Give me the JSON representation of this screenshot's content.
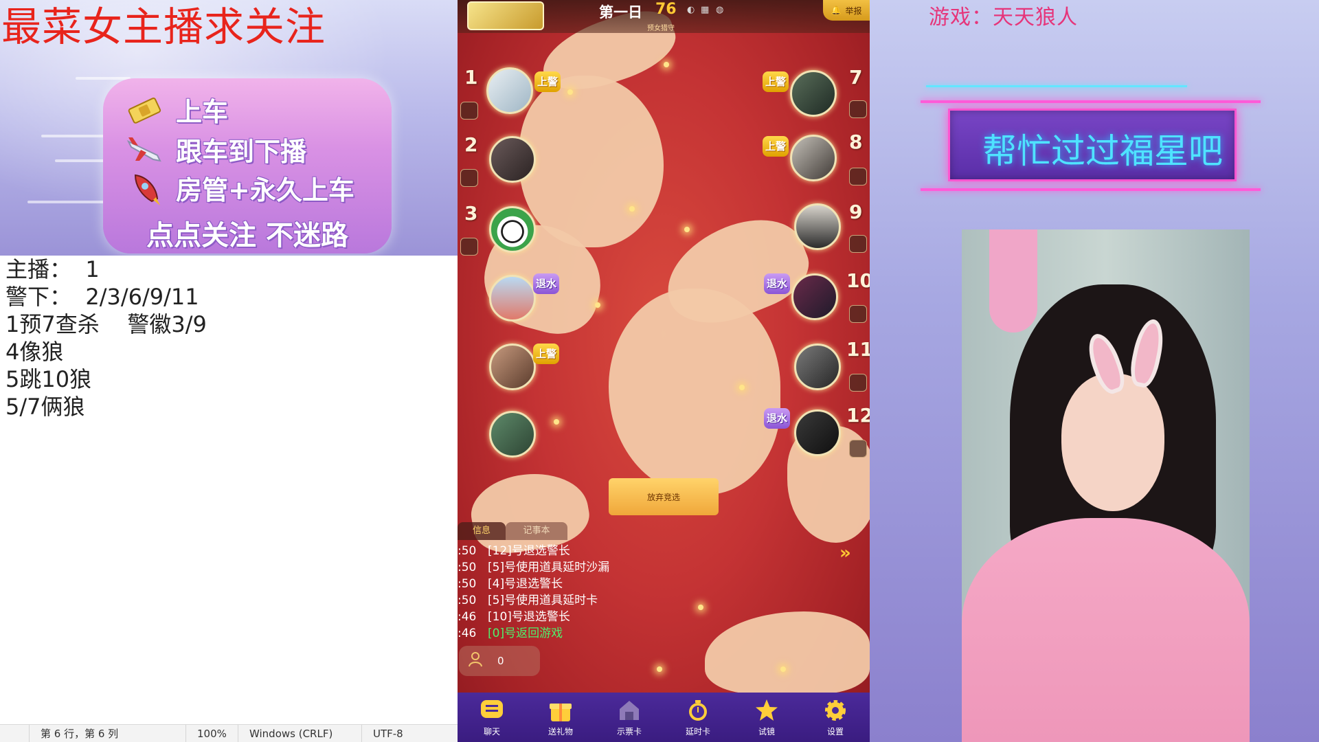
{
  "left": {
    "stream_title": "最菜女主播求关注",
    "promo": {
      "items": [
        {
          "icon": "ticket-icon",
          "label": "上车"
        },
        {
          "icon": "plane-icon",
          "label": "跟车到下播"
        },
        {
          "icon": "rocket-icon",
          "label": "房管+永久上车"
        }
      ],
      "follow": "点点关注  不迷路"
    }
  },
  "notepad": {
    "lines": [
      "主播：  1",
      "警下：  2/3/6/9/11",
      "1预7查杀    警徽3/9",
      "4像狼",
      "5跳10狼",
      "5/7俩狼"
    ],
    "status": {
      "position": "第 6 行，第 6 列",
      "zoom": "100%",
      "line_ending": "Windows (CRLF)",
      "encoding": "UTF-8"
    }
  },
  "game": {
    "day_label": "第一日",
    "timer": "76",
    "role_label": "预女猎守",
    "report": "举报",
    "left_seats": [
      {
        "num": "1",
        "badge": "上警",
        "badge_type": "up"
      },
      {
        "num": "2",
        "badge": "",
        "badge_type": ""
      },
      {
        "num": "3",
        "badge": "",
        "badge_type": ""
      },
      {
        "num": "",
        "badge": "退水",
        "badge_type": "retreat"
      },
      {
        "num": "",
        "badge": "上警",
        "badge_type": "up"
      },
      {
        "num": "",
        "badge": "",
        "badge_type": ""
      }
    ],
    "right_seats": [
      {
        "num": "7",
        "badge": "上警",
        "badge_type": "up"
      },
      {
        "num": "8",
        "badge": "上警",
        "badge_type": "up"
      },
      {
        "num": "9",
        "badge": "",
        "badge_type": ""
      },
      {
        "num": "10",
        "badge": "退水",
        "badge_type": "retreat"
      },
      {
        "num": "11",
        "badge": "",
        "badge_type": ""
      },
      {
        "num": "12",
        "badge": "退水",
        "badge_type": "retreat"
      }
    ],
    "abstain_button": "放弃竞选",
    "chat_tabs": [
      "信息",
      "记事本"
    ],
    "chat_log": [
      {
        "time": ":50",
        "msg": "[12]号退选警长",
        "color": "white"
      },
      {
        "time": ":50",
        "msg": "[5]号使用道具延时沙漏",
        "color": "white"
      },
      {
        "time": ":50",
        "msg": "[4]号退选警长",
        "color": "white"
      },
      {
        "time": ":50",
        "msg": "[5]号使用道具延时卡",
        "color": "white"
      },
      {
        "time": ":46",
        "msg": "[10]号退选警长",
        "color": "white"
      },
      {
        "time": ":46",
        "msg": "[0]号返回游戏",
        "color": "green"
      }
    ],
    "mic_count": "0",
    "bottom_bar": [
      {
        "icon": "chat-icon",
        "label": "聊天"
      },
      {
        "icon": "gift-icon",
        "label": "送礼物"
      },
      {
        "icon": "ticket-show-icon",
        "label": "示票卡"
      },
      {
        "icon": "timer-card-icon",
        "label": "延时卡"
      },
      {
        "icon": "star-icon",
        "label": "试镜"
      },
      {
        "icon": "settings-icon",
        "label": "设置"
      }
    ]
  },
  "right": {
    "game_name": "游戏：天天狼人",
    "banner_text": "帮忙过过福星吧"
  },
  "colors": {
    "title_red": "#e8241c",
    "neon_cyan": "#4fe3ff",
    "neon_pink": "#ff55d0",
    "game_red": "#c43334",
    "gold": "#ffc934"
  }
}
